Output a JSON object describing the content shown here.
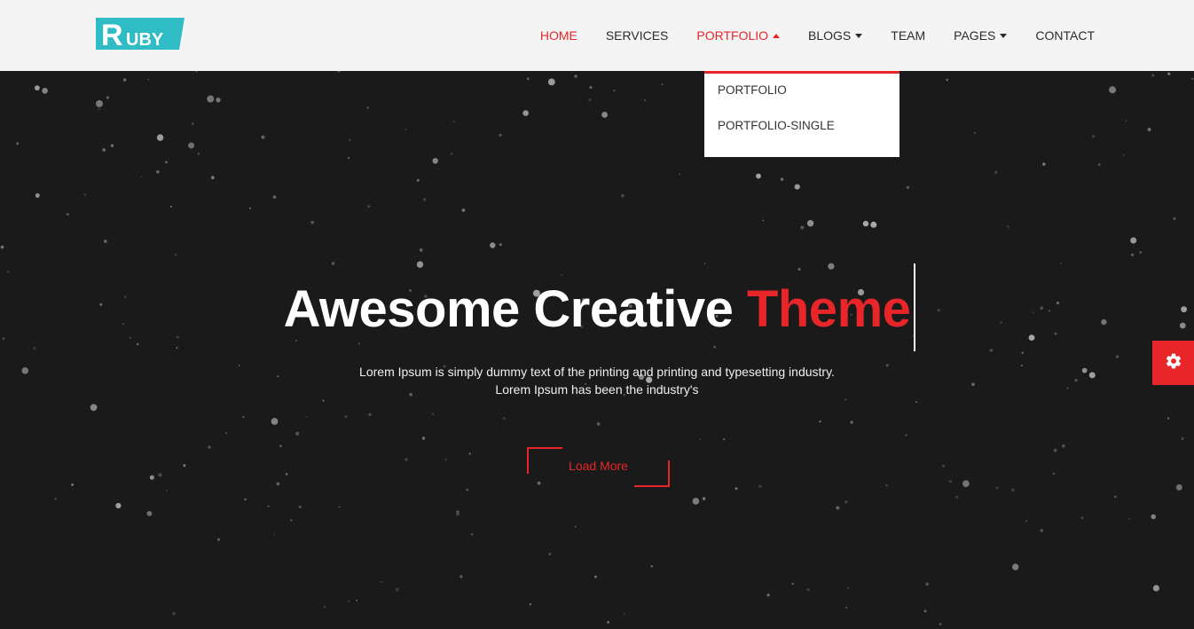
{
  "brand": {
    "logo_text": "RUBY",
    "logo_color": "#2fbcc4"
  },
  "colors": {
    "accent": "#e8262a",
    "hero_bg": "#1a1a1b",
    "header_bg": "#f4f4f4"
  },
  "nav": {
    "items": [
      {
        "label": "HOME",
        "active": true,
        "has_dropdown": false
      },
      {
        "label": "SERVICES",
        "active": false,
        "has_dropdown": false
      },
      {
        "label": "PORTFOLIO",
        "active": true,
        "has_dropdown": true,
        "open": true
      },
      {
        "label": "BLOGS",
        "active": false,
        "has_dropdown": true
      },
      {
        "label": "TEAM",
        "active": false,
        "has_dropdown": false
      },
      {
        "label": "PAGES",
        "active": false,
        "has_dropdown": true
      },
      {
        "label": "CONTACT",
        "active": false,
        "has_dropdown": false
      }
    ]
  },
  "portfolio_dropdown": {
    "items": [
      {
        "label": "PORTFOLIO"
      },
      {
        "label": "PORTFOLIO-SINGLE"
      }
    ]
  },
  "hero": {
    "title_main": "Awesome Creative ",
    "title_accent": "Theme",
    "description_line1": "Lorem Ipsum is simply dummy text of the printing and printing and typesetting industry.",
    "description_line2": "Lorem Ipsum has been the industry's",
    "cta_label": "Load More"
  },
  "settings": {
    "icon": "gear-icon"
  }
}
